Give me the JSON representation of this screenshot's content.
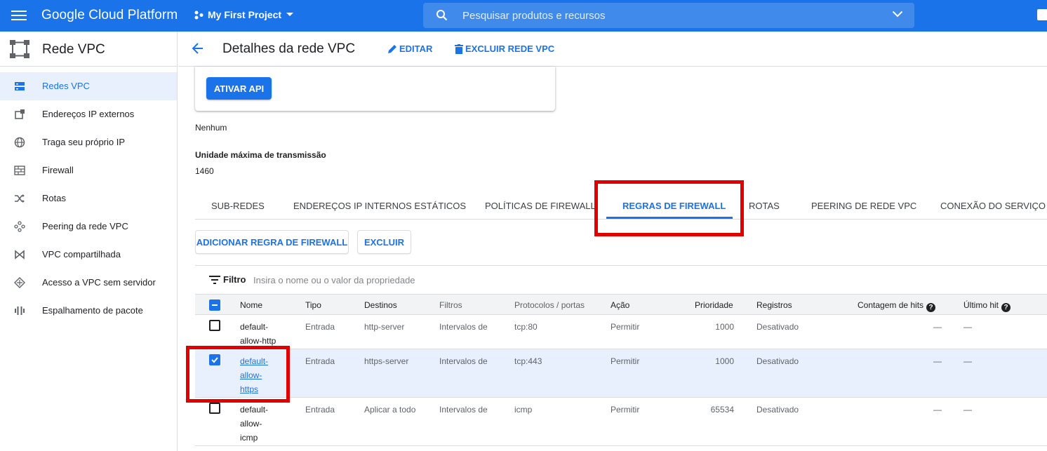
{
  "topbar": {
    "brand": "Google Cloud Platform",
    "project": "My First Project",
    "search_placeholder": "Pesquisar produtos e recursos"
  },
  "sidebar": {
    "title": "Rede VPC",
    "items": [
      {
        "label": "Redes VPC",
        "icon": "vpc-networks-icon",
        "active": true
      },
      {
        "label": "Endereços IP externos",
        "icon": "external-ip-icon"
      },
      {
        "label": "Traga seu próprio IP",
        "icon": "globe-icon"
      },
      {
        "label": "Firewall",
        "icon": "firewall-icon"
      },
      {
        "label": "Rotas",
        "icon": "routes-icon"
      },
      {
        "label": "Peering da rede VPC",
        "icon": "peering-icon"
      },
      {
        "label": "VPC compartilhada",
        "icon": "shared-vpc-icon"
      },
      {
        "label": "Acesso a VPC sem servidor",
        "icon": "serverless-access-icon"
      },
      {
        "label": "Espalhamento de pacote",
        "icon": "packet-mirroring-icon"
      }
    ]
  },
  "header": {
    "title": "Detalhes da rede VPC",
    "edit_label": "EDITAR",
    "delete_label": "EXCLUIR REDE VPC"
  },
  "card": {
    "activate_label": "ATIVAR API"
  },
  "details": {
    "none_value": "Nenhum",
    "mtu_label": "Unidade máxima de transmissão",
    "mtu_value": "1460"
  },
  "tabs": [
    {
      "label": "SUB-REDES"
    },
    {
      "label": "ENDEREÇOS IP INTERNOS ESTÁTICOS"
    },
    {
      "label": "POLÍTICAS DE FIREWALL"
    },
    {
      "label": "REGRAS DE FIREWALL",
      "active": true
    },
    {
      "label": "ROTAS"
    },
    {
      "label": "PEERING DE REDE VPC"
    },
    {
      "label": "CONEXÃO DO SERVIÇO PA"
    }
  ],
  "actions": {
    "add_rule_label": "ADICIONAR REGRA DE FIREWALL",
    "delete_label": "EXCLUIR"
  },
  "filter": {
    "label": "Filtro",
    "placeholder": "Insira o nome ou o valor da propriedade"
  },
  "table": {
    "headers": {
      "name": "Nome",
      "type": "Tipo",
      "targets": "Destinos",
      "filters": "Filtros",
      "protocols": "Protocolos / portas",
      "action": "Ação",
      "priority": "Prioridade",
      "logs": "Registros",
      "hit_count": "Contagem de hits",
      "last_hit": "Último hit"
    },
    "rows": [
      {
        "name": "default-allow-http",
        "type": "Entrada",
        "targets": "http-server",
        "filters": "Intervalos de",
        "protocols": "tcp:80",
        "action": "Permitir",
        "priority": "1000",
        "logs": "Desativado",
        "hit_count": "—",
        "last_hit": "—",
        "checked": false
      },
      {
        "name": "default-allow-https",
        "type": "Entrada",
        "targets": "https-server",
        "filters": "Intervalos de",
        "protocols": "tcp:443",
        "action": "Permitir",
        "priority": "1000",
        "logs": "Desativado",
        "hit_count": "—",
        "last_hit": "—",
        "checked": true
      },
      {
        "name": "default-allow-icmp",
        "type": "Entrada",
        "targets": "Aplicar a todo",
        "filters": "Intervalos de",
        "protocols": "icmp",
        "action": "Permitir",
        "priority": "65534",
        "logs": "Desativado",
        "hit_count": "—",
        "last_hit": "—",
        "checked": false
      }
    ]
  }
}
